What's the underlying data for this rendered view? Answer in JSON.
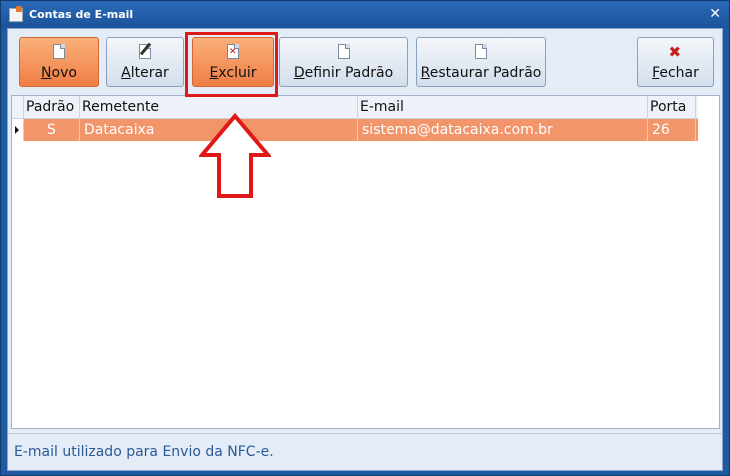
{
  "window": {
    "title": "Contas de E-mail",
    "close_glyph": "✕"
  },
  "toolbar": {
    "novo_label": "Novo",
    "alterar_label": "Alterar",
    "excluir_label": "Excluir",
    "definir_label": "Definir Padrão",
    "restaurar_label": "Restaurar Padrão",
    "fechar_label": "Fechar",
    "fechar_icon_glyph": "✖"
  },
  "grid": {
    "columns": [
      "Padrão",
      "Remetente",
      "E-mail",
      "Porta"
    ],
    "rows": [
      {
        "padrao": "S",
        "remetente": "Datacaixa",
        "email": "sistema@datacaixa.com.br",
        "porta": "26"
      }
    ]
  },
  "status": {
    "text": "E-mail utilizado para Envio da NFC-e."
  },
  "colors": {
    "accent": "#ef7d45",
    "annotation": "#e01818"
  }
}
